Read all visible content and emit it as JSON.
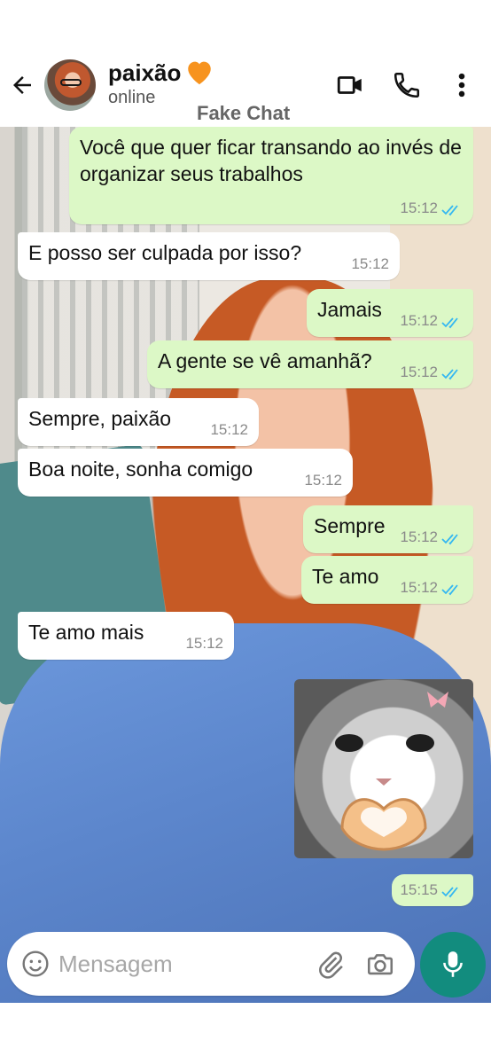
{
  "header": {
    "contact_name": "paixão",
    "status": "online",
    "watermark": "Fake Chat"
  },
  "composer": {
    "placeholder": "Mensagem"
  },
  "messages": [
    {
      "direction": "outgoing",
      "text": "Você que quer ficar transando ao invés de organizar seus trabalhos",
      "time": "15:12",
      "read": true
    },
    {
      "direction": "incoming",
      "text": "E posso ser culpada por isso?",
      "time": "15:12"
    },
    {
      "direction": "outgoing",
      "text": "Jamais",
      "time": "15:12",
      "read": true
    },
    {
      "direction": "outgoing",
      "text": "A gente se vê amanhã?",
      "time": "15:12",
      "read": true
    },
    {
      "direction": "incoming",
      "text": "Sempre, paixão",
      "time": "15:12"
    },
    {
      "direction": "incoming",
      "text": "Boa noite, sonha comigo",
      "time": "15:12"
    },
    {
      "direction": "outgoing",
      "text": "Sempre",
      "time": "15:12",
      "read": true
    },
    {
      "direction": "outgoing",
      "text": "Te amo",
      "time": "15:12",
      "read": true
    },
    {
      "direction": "incoming",
      "text": "Te amo mais",
      "time": "15:12"
    },
    {
      "direction": "outgoing",
      "type": "sticker",
      "sticker": "cat-heart-hands",
      "time": "15:15",
      "read": true
    }
  ],
  "colors": {
    "outgoing_bubble": "#dcf8c6",
    "incoming_bubble": "#ffffff",
    "accent": "#128c7e",
    "read_ticks": "#34b7f1",
    "heart_emoji": "#f7931e"
  },
  "icons": [
    "back-arrow-icon",
    "orange-heart-icon",
    "video-call-icon",
    "phone-icon",
    "more-options-icon",
    "emoji-icon",
    "attach-icon",
    "camera-icon",
    "mic-icon",
    "double-check-icon"
  ]
}
